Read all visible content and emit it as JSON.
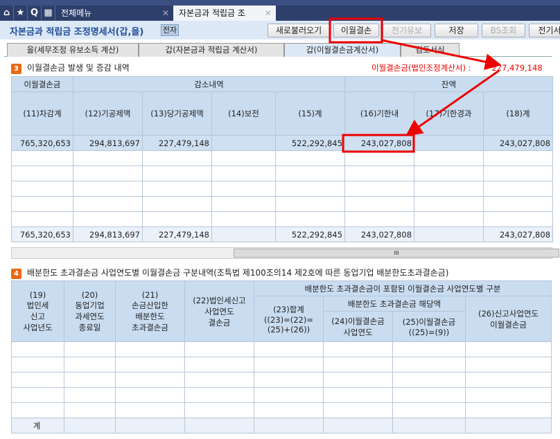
{
  "nav": {
    "icons": [
      "home-icon",
      "star-icon",
      "search-icon",
      "calendar-icon"
    ],
    "search_glyph": "Q",
    "tabs": [
      {
        "label": "전체메뉴"
      },
      {
        "label": "자본금과 적립금 조"
      }
    ]
  },
  "header": {
    "title": "자본금과 적립금 조정명세서(갑,을)",
    "elec": "전자",
    "buttons": [
      "새로불러오기",
      "이월결손",
      "전기유보",
      "저장",
      "BS조회",
      "전기서"
    ]
  },
  "subtabs": [
    "을(세무조정 유보소득 계산)",
    "갑(자본금과 적립금 계산서)",
    "갑(이월결손금계산서)",
    "검토서식"
  ],
  "section3": {
    "num": "3",
    "title": "이월결손금 발생 및 증감 내역",
    "ref_label": "이월결손금(법인조정계산서) :",
    "ref_value": "227,479,148",
    "groups": [
      "이월결손금",
      "감소내역",
      "잔액"
    ],
    "columns": [
      "(11)차감계",
      "(12)기공제액",
      "(13)당기공제액",
      "(14)보전",
      "(15)계",
      "(16)기한내",
      "(17)기한경과",
      "(18)계"
    ],
    "row": [
      "765,320,653",
      "294,813,697",
      "227,479,148",
      "",
      "522,292,845",
      "243,027,808",
      "",
      "243,027,808"
    ],
    "total": [
      "765,320,653",
      "294,813,697",
      "227,479,148",
      "",
      "522,292,845",
      "243,027,808",
      "",
      "243,027,808"
    ],
    "scroll_grip": "III"
  },
  "section4": {
    "num": "4",
    "title": "배분한도 초과결손금 사업연도별 이월결손금 구분내역(조특법 제100조의14 제2호에 따른 동업기업 배분한도초과결손금)",
    "col19": [
      "(19)",
      "법인세",
      "신고",
      "사업년도"
    ],
    "col20": [
      "(20)",
      "동업기업",
      "과세연도",
      "종료일"
    ],
    "col21": [
      "(21)",
      "손금산입한",
      "배분한도",
      "초과결손금"
    ],
    "col22": [
      "(22)법인세신고",
      "사업연도",
      "결손금"
    ],
    "group_top": "배분한도 초과결손금이 포함된 이월결손금 사업연도별 구분",
    "col23": [
      "(23)합계",
      "((23)=(22)=",
      "(25)+(26))"
    ],
    "group_sub": "배분한도 초과결손금 해당액",
    "col24": [
      "(24)이월결손금",
      "사업연도"
    ],
    "col25": [
      "(25)이월결손금",
      "((25)=(9))"
    ],
    "col26": [
      "(26)신고사업연도",
      "이월결손금"
    ],
    "total_label": "계"
  }
}
